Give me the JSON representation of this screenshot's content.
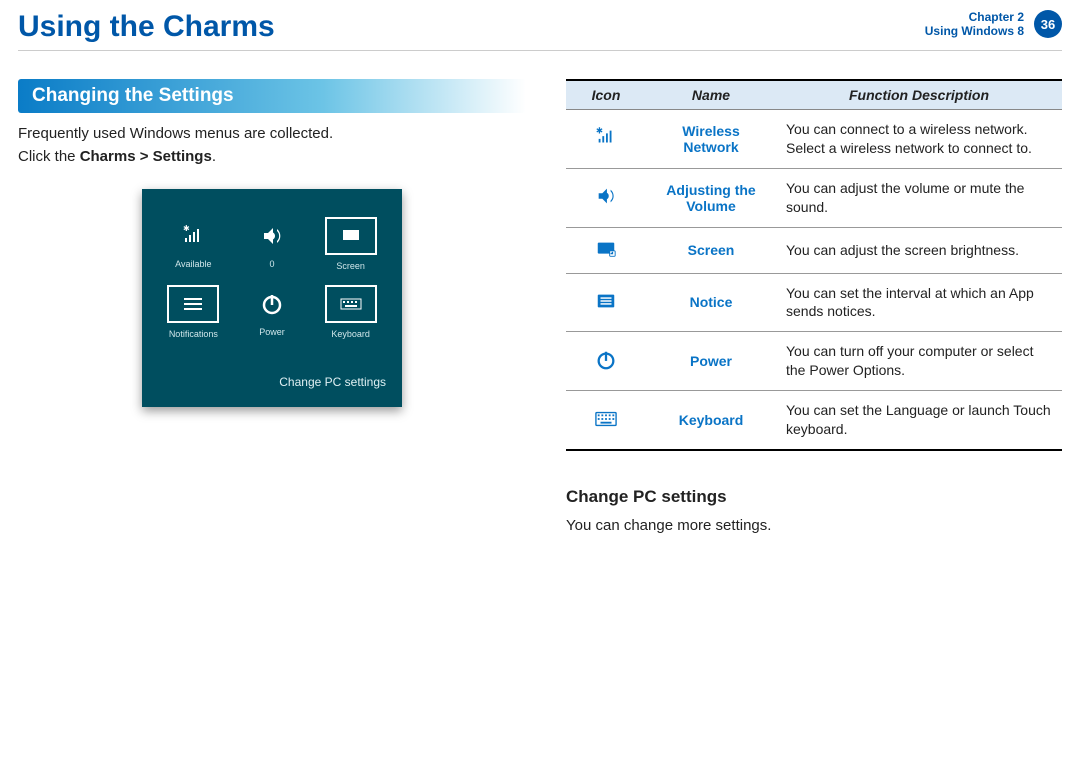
{
  "header": {
    "title": "Using the Charms",
    "chapter_label": "Chapter 2",
    "section_label": "Using Windows 8",
    "page_number": "36"
  },
  "left": {
    "section_heading": "Changing the Settings",
    "intro_line1": "Frequently used Windows menus are collected.",
    "intro_line2_pre": "Click the ",
    "intro_line2_bold": "Charms > Settings",
    "intro_line2_post": ".",
    "panel": {
      "tiles": [
        {
          "label": "Available"
        },
        {
          "label": "0"
        },
        {
          "label": "Screen"
        },
        {
          "label": "Notifications"
        },
        {
          "label": "Power"
        },
        {
          "label": "Keyboard"
        }
      ],
      "footer": "Change PC settings"
    }
  },
  "table": {
    "headers": {
      "icon": "Icon",
      "name": "Name",
      "desc": "Function Description"
    },
    "rows": [
      {
        "name": "Wireless Network",
        "desc": "You can connect to a wireless network. Select a wireless network to connect to."
      },
      {
        "name": "Adjusting the Volume",
        "desc": "You can adjust the volume or mute the sound."
      },
      {
        "name": "Screen",
        "desc": "You can adjust the screen brightness."
      },
      {
        "name": "Notice",
        "desc": "You can set the interval at which an App sends notices."
      },
      {
        "name": "Power",
        "desc": "You can turn off your computer or select the Power Options."
      },
      {
        "name": "Keyboard",
        "desc": "You can set the Language or launch Touch keyboard."
      }
    ]
  },
  "sub": {
    "heading": "Change PC settings",
    "body": "You can change more settings."
  }
}
